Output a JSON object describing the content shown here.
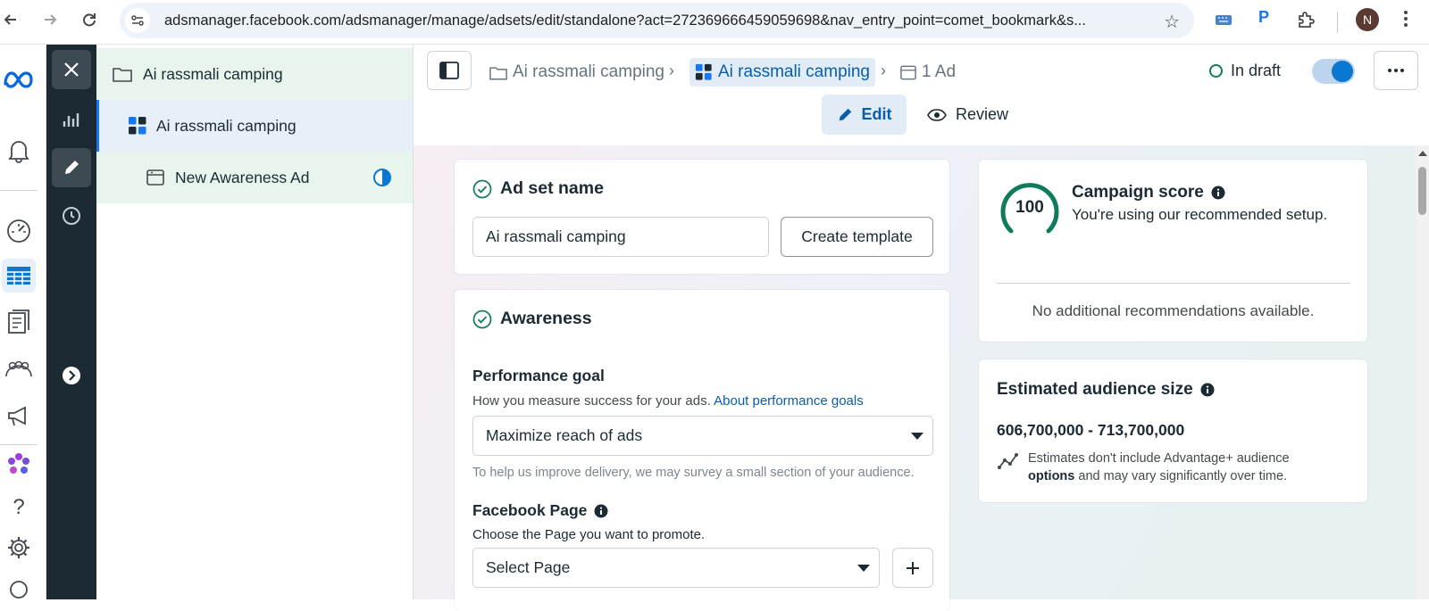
{
  "browser": {
    "url": "adsmanager.facebook.com/adsmanager/manage/adsets/edit/standalone?act=272369666459059698&nav_entry_point=comet_bookmark&s...",
    "profile_initial": "N",
    "ext_p_label": "P"
  },
  "tree": {
    "campaign": "Ai rassmali camping",
    "adset": "Ai rassmali camping",
    "ad": "New Awareness Ad"
  },
  "breadcrumb": {
    "campaign": "Ai rassmali camping",
    "adset": "Ai rassmali camping",
    "ad": "1 Ad"
  },
  "status": {
    "label": "In draft"
  },
  "tabs": {
    "edit": "Edit",
    "review": "Review"
  },
  "adset_name_card": {
    "title": "Ad set name",
    "value": "Ai rassmali camping",
    "create_template": "Create template"
  },
  "awareness_card": {
    "title": "Awareness",
    "performance_goal_label": "Performance goal",
    "performance_goal_desc": "How you measure success for your ads.",
    "performance_goal_link": "About performance goals",
    "performance_goal_value": "Maximize reach of ads",
    "survey_hint": "To help us improve delivery, we may survey a small section of your audience.",
    "facebook_page_label": "Facebook Page",
    "facebook_page_desc": "Choose the Page you want to promote.",
    "page_select_value": "Select Page"
  },
  "campaign_score": {
    "score": "100",
    "title": "Campaign score",
    "desc": "You're using our recommended setup.",
    "no_recs": "No additional recommendations available."
  },
  "audience": {
    "title": "Estimated audience size",
    "range": "606,700,000 - 713,700,000",
    "note_line1": "Estimates don't include Advantage+ audience",
    "note_line2_bold": "options",
    "note_line2_rest": " and may vary significantly over time."
  },
  "colors": {
    "accent": "#0a78d1",
    "link": "#0a5ea8",
    "success": "#0f7b5c",
    "dark_rail": "#1c2b33"
  }
}
